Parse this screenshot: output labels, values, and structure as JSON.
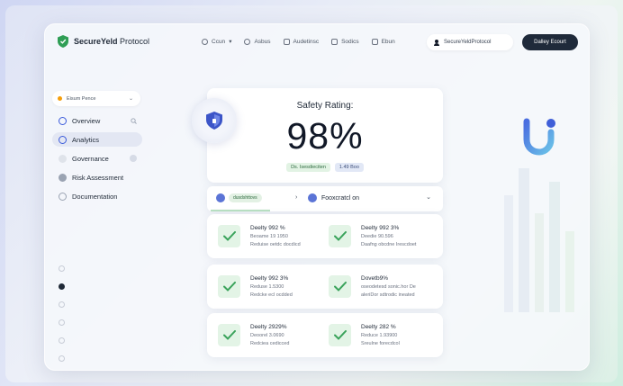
{
  "header": {
    "brand": "SecureYeld Protocol",
    "brand_bold": "SecureYeld",
    "brand_rest": " Protocol",
    "nav": [
      {
        "label": "Ccun",
        "icon": "circle-icon",
        "suffix": "▾"
      },
      {
        "label": "Asbus",
        "icon": "circle-icon"
      },
      {
        "label": "Audetinsc",
        "icon": "grid-icon"
      },
      {
        "label": "Sodics",
        "icon": "building-icon"
      },
      {
        "label": "Ebun",
        "icon": "document-icon"
      }
    ],
    "wallet_label": "SecureYeldProtocol",
    "connect_label": "Dalley Ecourt"
  },
  "sidebar": {
    "selector_label": "Eisum Pence",
    "items": [
      {
        "label": "Overview",
        "active": false
      },
      {
        "label": "Analytics",
        "active": true
      },
      {
        "label": "Governance",
        "active": false
      },
      {
        "label": "Risk Assessment",
        "active": false
      },
      {
        "label": "Documentation",
        "active": false
      }
    ],
    "pager_active": 2
  },
  "rating": {
    "title": "Safety Rating:",
    "value": "98%",
    "tag_green": "Ds. Isesdieciten",
    "tag_blue": "1.49 Boo"
  },
  "filter": {
    "chip": "dusdshttovs",
    "arrow": "›",
    "right_label": "Fooxcratcl on",
    "chevron": "⌄"
  },
  "checks": [
    [
      {
        "title": "Deelty 992 %",
        "sub1": "Beoame 19 1950",
        "sub2": "Reduise oetdc docdicd"
      },
      {
        "title": "Deelty 992 3%",
        "sub1": "Deedie 90.596",
        "sub2": "Daafng obcdne Irescdoet"
      }
    ],
    [
      {
        "title": "Deelty 992 3%",
        "sub1": "Reduse 1.5300",
        "sub2": "Redcke ecl ocdded"
      },
      {
        "title": "Dovetb9%",
        "sub1": "oseodetesd sonic.hor De",
        "sub2": "aleriDor sdtrodic ineated"
      }
    ],
    [
      {
        "title": "Deelty 2929%",
        "sub1": "Deoorel 3.0690",
        "sub2": "Redciea cedicced"
      },
      {
        "title": "Deelty 282 %",
        "sub1": "Reduce 1.93900",
        "sub2": "Sreulne forecdcol"
      }
    ]
  ],
  "colors": {
    "accent": "#3b5bdb",
    "check_green": "#3aa35b",
    "button_dark": "#1f2a3a"
  }
}
